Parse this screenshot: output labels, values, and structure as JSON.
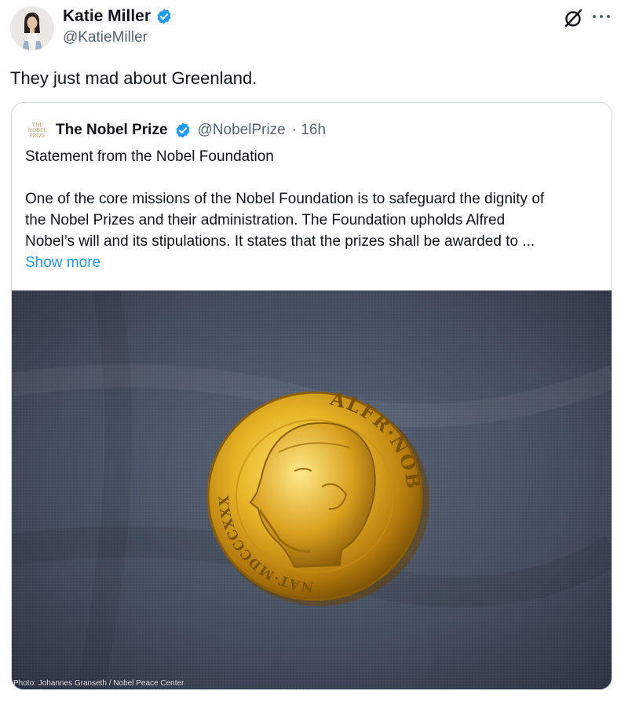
{
  "post": {
    "author": {
      "name": "Katie Miller",
      "handle": "@KatieMiller",
      "verified": true
    },
    "text": "They just mad about Greenland.",
    "icons": [
      "verified-badge-icon",
      "grok-icon",
      "more-icon"
    ]
  },
  "quote": {
    "author": {
      "name": "The Nobel Prize",
      "handle": "@NobelPrize",
      "time": "· 16h",
      "logo_text": [
        "THE",
        "NOBEL",
        "PRIZE"
      ]
    },
    "title": "Statement from the Nobel Foundation",
    "lines": [
      "One of the core missions of the Nobel Foundation is to safeguard the dignity of",
      "the Nobel Prizes and their administration. The Foundation upholds Alfred",
      "Nobel’s will and its stipulations. It states that the prizes shall be awarded to ..."
    ],
    "show_more": "Show more",
    "media": {
      "medal_inscription_top": "ALFR·NOBEL",
      "medal_inscription_left": "NAT·MDCCCXXXIII·OB·MDCCCXCVI",
      "credit": "Photo: Johannes Granseth / Nobel Peace Center"
    }
  },
  "colors": {
    "text": "#0f1419",
    "secondary": "#536471",
    "link": "#1d9bf0",
    "border": "#cfd9de",
    "verified": "#1d9bf0"
  }
}
